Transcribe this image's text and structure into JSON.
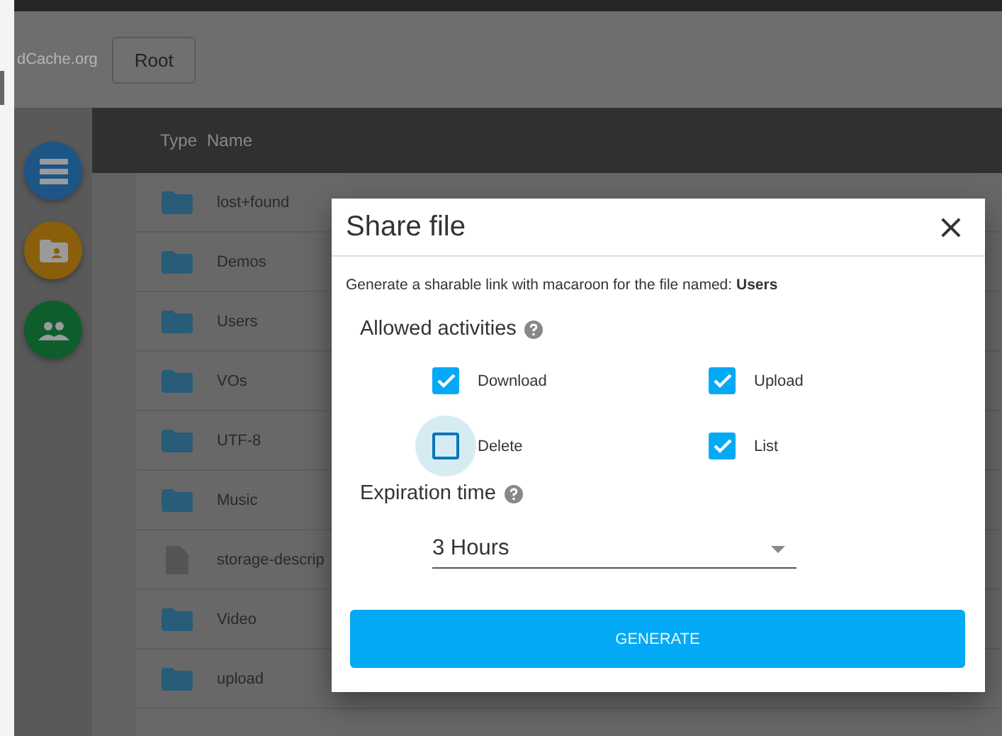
{
  "header": {
    "brand": "dCache.org",
    "root_button": "Root"
  },
  "sidebar": {
    "buttons": [
      {
        "kind": "list"
      },
      {
        "kind": "folder"
      },
      {
        "kind": "people"
      }
    ]
  },
  "table": {
    "columns": [
      "Type",
      "Name"
    ],
    "rows": [
      {
        "kind": "folder",
        "name": "lost+found"
      },
      {
        "kind": "folder",
        "name": "Demos"
      },
      {
        "kind": "folder",
        "name": "Users"
      },
      {
        "kind": "folder",
        "name": "VOs"
      },
      {
        "kind": "folder",
        "name": "UTF-8"
      },
      {
        "kind": "folder",
        "name": "Music"
      },
      {
        "kind": "file",
        "name": "storage-descrip"
      },
      {
        "kind": "folder",
        "name": "Video"
      },
      {
        "kind": "folder",
        "name": "upload"
      }
    ]
  },
  "dialog": {
    "title": "Share file",
    "close": "×",
    "description": "Generate a sharable link with macaroon for the file named: **Users**",
    "activities_label": "Allowed activities",
    "activities": [
      {
        "label": "Download",
        "checked": true,
        "focused": false
      },
      {
        "label": "Upload",
        "checked": true,
        "focused": false
      },
      {
        "label": "Delete",
        "checked": false,
        "focused": true
      },
      {
        "label": "List",
        "checked": true,
        "focused": false
      }
    ],
    "expiration_label": "Expiration time",
    "expiration": {
      "value": "3 Hours"
    },
    "generate_button": "GENERATE"
  }
}
